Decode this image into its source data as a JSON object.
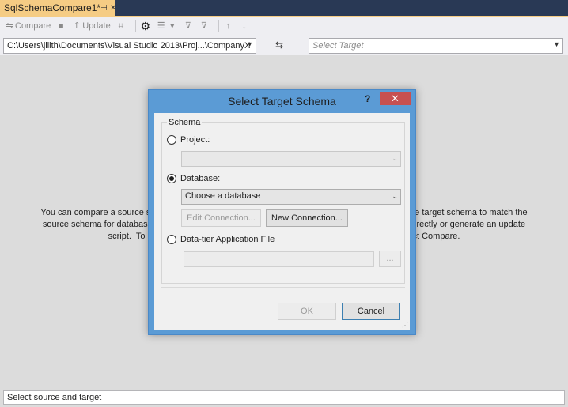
{
  "tab": {
    "title": "SqlSchemaCompare1*",
    "pin_icon": "pin-icon",
    "close_icon": "close-icon"
  },
  "toolbar": {
    "compare_label": "Compare",
    "update_label": "Update",
    "icons": [
      "compare-icon",
      "stop-icon",
      "update-icon",
      "generate-script-icon",
      "options-icon",
      "group-results-icon",
      "filter-icon",
      "filter-settings-icon",
      "previous-change-icon",
      "next-change-icon"
    ]
  },
  "selectors": {
    "source_value": "C:\\Users\\jillth\\Documents\\Visual Studio 2013\\Proj...\\CompanyX",
    "target_placeholder": "Select Target"
  },
  "main": {
    "intro_line1": "You can compare a source schema wit                                                                              update the target schema to match the",
    "intro_line2": "source schema for database objects y                                                                              e target directly or generate an update",
    "intro_line3": "script.  To con                                                                                                   elect Compare."
  },
  "status": {
    "text": "Select source and target"
  },
  "dialog": {
    "title": "Select Target Schema",
    "help": "?",
    "close": "✕",
    "group_label": "Schema",
    "project_label": "Project:",
    "database_label": "Database:",
    "database_value": "Choose a database",
    "edit_connection": "Edit Connection...",
    "new_connection": "New Connection...",
    "dacpac_label": "Data-tier Application File",
    "browse": "...",
    "ok": "OK",
    "cancel": "Cancel",
    "selected_option": "Database",
    "accent_color": "#5b9bd5",
    "close_color": "#c75050"
  }
}
